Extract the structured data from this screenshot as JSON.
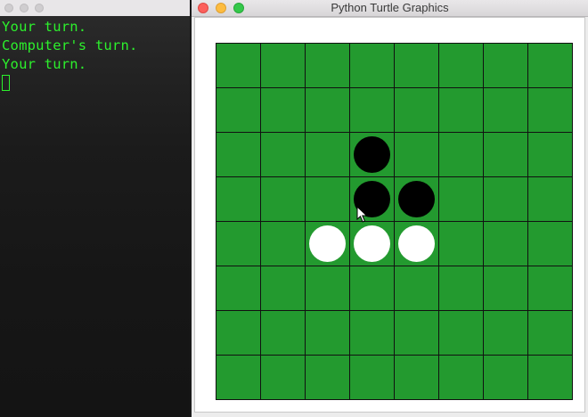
{
  "terminal": {
    "lines": [
      "Your turn.",
      "Computer's turn.",
      "Your turn."
    ]
  },
  "turtle_window": {
    "title": "Python Turtle Graphics"
  },
  "board": {
    "size": 8,
    "board_color": "#239a2f",
    "line_color": "#111111",
    "pieces": [
      {
        "row": 2,
        "col": 3,
        "color": "black"
      },
      {
        "row": 3,
        "col": 3,
        "color": "black"
      },
      {
        "row": 3,
        "col": 4,
        "color": "black"
      },
      {
        "row": 4,
        "col": 2,
        "color": "white"
      },
      {
        "row": 4,
        "col": 3,
        "color": "white"
      },
      {
        "row": 4,
        "col": 4,
        "color": "white"
      }
    ]
  },
  "colors": {
    "terminal_text": "#2cf02c",
    "black_piece": "#000000",
    "white_piece": "#ffffff"
  },
  "icons": {
    "mouse_pointer": "mouse-pointer-icon"
  }
}
